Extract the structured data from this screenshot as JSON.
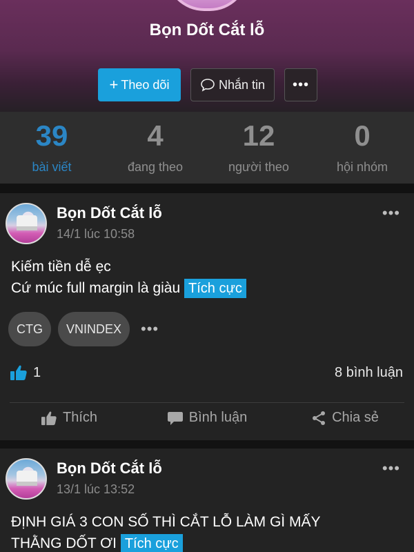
{
  "profile": {
    "name": "Bọn Dốt Cắt lỗ",
    "follow_label": "Theo dõi",
    "message_label": "Nhắn tin",
    "more_label": "•••"
  },
  "stats": [
    {
      "value": "39",
      "label": "bài viết",
      "active": true
    },
    {
      "value": "4",
      "label": "đang theo",
      "active": false
    },
    {
      "value": "12",
      "label": "người theo",
      "active": false
    },
    {
      "value": "0",
      "label": "hội nhóm",
      "active": false
    }
  ],
  "posts": [
    {
      "author": "Bọn Dốt Cắt lỗ",
      "time": "14/1 lúc 10:58",
      "line1": "Kiếm tiền dễ ẹc",
      "line2": "Cứ múc full margin là giàu",
      "sentiment": "Tích cực",
      "tags": [
        "CTG",
        "VNINDEX"
      ],
      "likes": "1",
      "comments": "8 bình luận"
    },
    {
      "author": "Bọn Dốt Cắt lỗ",
      "time": "13/1 lúc 13:52",
      "line1": "ĐỊNH GIÁ 3 CON SỐ THÌ CẮT LỖ LÀM GÌ MẤY",
      "line2": "THẰNG DỐT ƠI",
      "sentiment": "Tích cực"
    }
  ],
  "actions": {
    "like": "Thích",
    "comment": "Bình luận",
    "share": "Chia sẻ"
  },
  "colors": {
    "accent": "#1aa0dc",
    "active_stat": "#2b86c5",
    "card_bg": "#232323"
  }
}
